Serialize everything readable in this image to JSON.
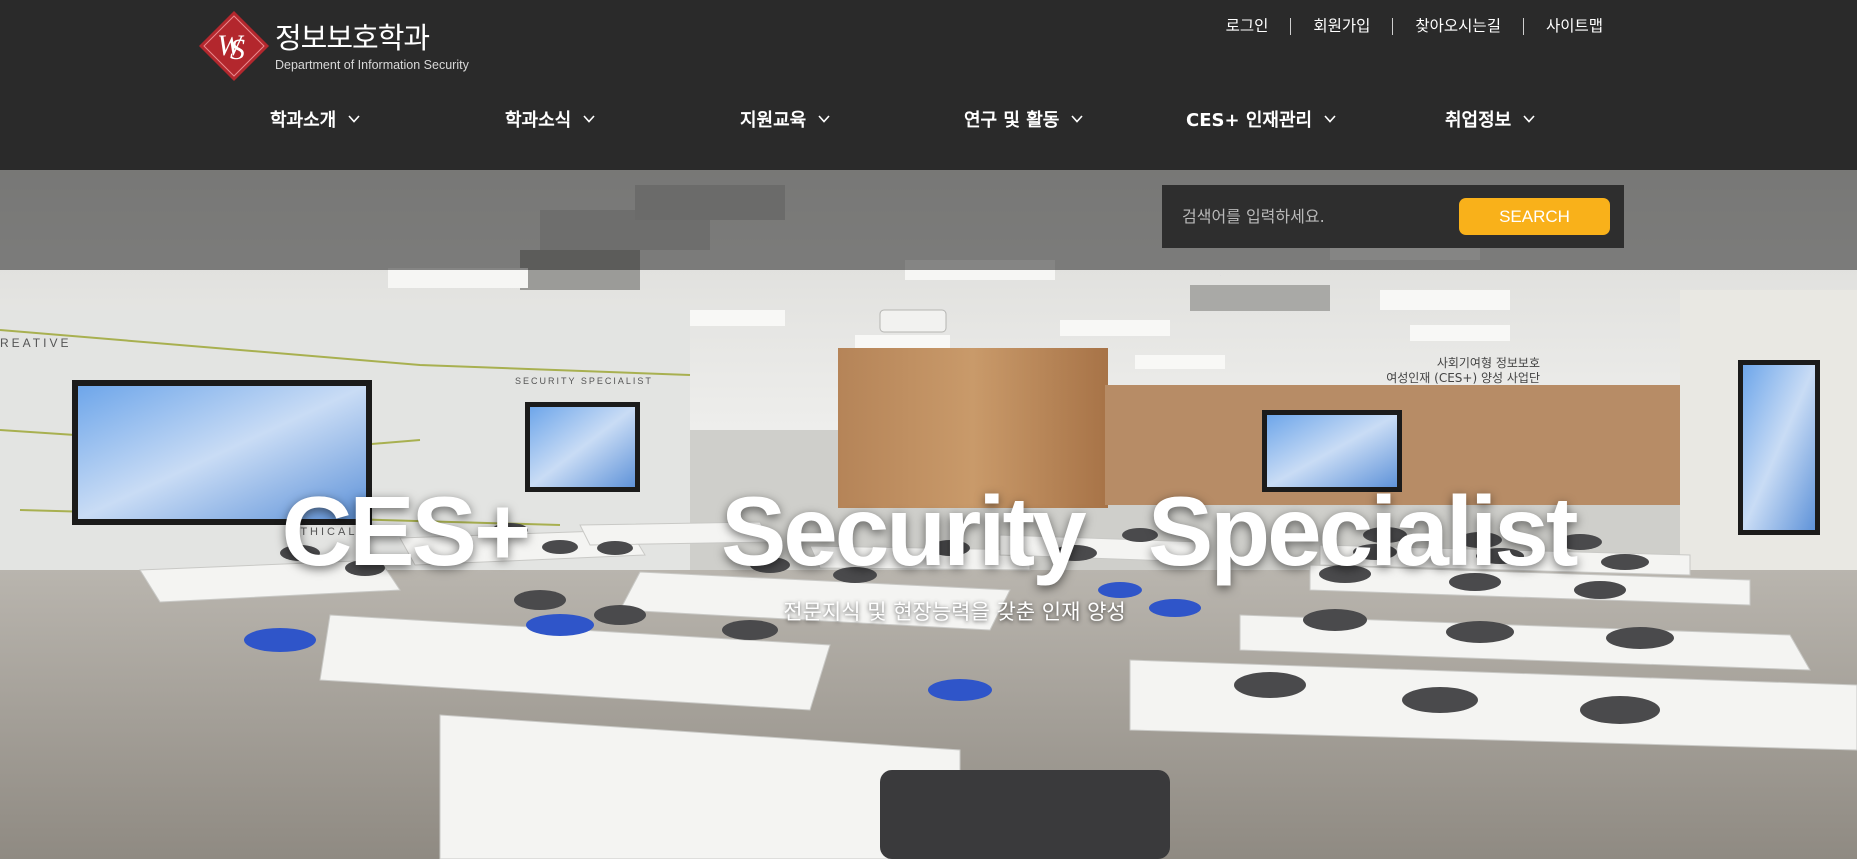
{
  "brand": {
    "title": "정보보호학과",
    "subtitle": "Department of Information Security",
    "colors": {
      "mark": "#b3272d",
      "header_bg": "#2a2a2a",
      "search_button": "#f9b11a"
    }
  },
  "util_nav": [
    {
      "label": "로그인"
    },
    {
      "label": "회원가입"
    },
    {
      "label": "찾아오시는길"
    },
    {
      "label": "사이트맵"
    }
  ],
  "gnb": [
    {
      "label": "학과소개",
      "icon": "chevron-down-icon"
    },
    {
      "label": "학과소식",
      "icon": "chevron-down-icon"
    },
    {
      "label": "지원교육",
      "icon": "chevron-down-icon"
    },
    {
      "label": "연구 및 활동",
      "icon": "chevron-down-icon"
    },
    {
      "label": "CES+ 인재관리",
      "icon": "chevron-down-icon"
    },
    {
      "label": "취업정보",
      "icon": "chevron-down-icon"
    }
  ],
  "search": {
    "placeholder": "검색어를 입력하세요.",
    "button_label": "SEARCH"
  },
  "hero": {
    "title_left": "CES+",
    "title_right": "Security Specialist",
    "subtitle": "전문지식 및 현장능력을 갖춘 인재 양성",
    "photo_text": {
      "wall_left": "REATIVE",
      "wall_left_2": "SECURITY SPECIALIST",
      "wall_left_3": "ETHICAL",
      "sign_line1": "사회기여형 정보보호",
      "sign_line2": "여성인재 (CES+) 양성 사업단"
    }
  }
}
